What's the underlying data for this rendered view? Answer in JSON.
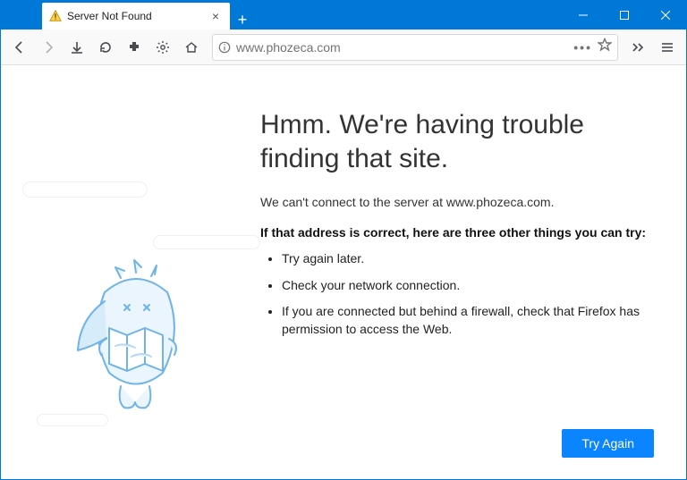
{
  "tab": {
    "title": "Server Not Found"
  },
  "url": {
    "value": "www.phozeca.com"
  },
  "error": {
    "heading": "Hmm. We're having trouble finding that site.",
    "subtext": "We can't connect to the server at www.phozeca.com.",
    "bold_intro": "If that address is correct, here are three other things you can try:",
    "tips": [
      "Try again later.",
      "Check your network connection.",
      "If you are connected but behind a firewall, check that Firefox has permission to access the Web."
    ],
    "try_again_label": "Try Again"
  }
}
